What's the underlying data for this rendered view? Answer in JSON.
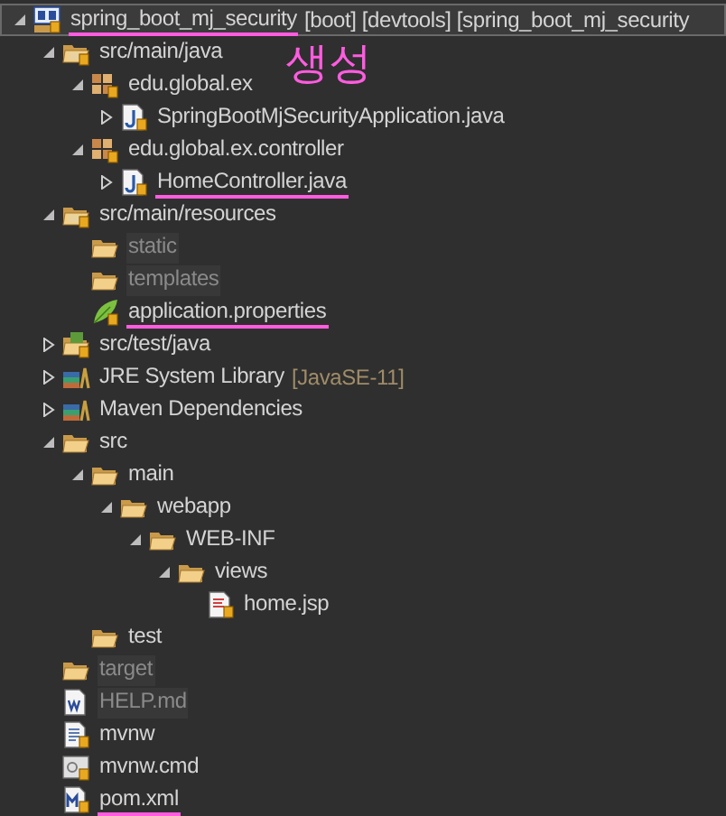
{
  "annotation": {
    "text": "생성"
  },
  "tree": [
    {
      "label": "spring_boot_mj_security",
      "decoration": "[boot] [devtools] [spring_boot_mj_security",
      "kind": "project",
      "expanded": true,
      "selected": true,
      "dimmed": false,
      "underlined": true,
      "children": [
        {
          "label": "src/main/java",
          "kind": "source-folder",
          "expanded": true,
          "selected": false,
          "dimmed": false,
          "underlined": false,
          "children": [
            {
              "label": "edu.global.ex",
              "kind": "package",
              "expanded": true,
              "selected": false,
              "dimmed": false,
              "underlined": false,
              "children": [
                {
                  "label": "SpringBootMjSecurityApplication.java",
                  "kind": "java-file",
                  "expanded": false,
                  "selected": false,
                  "dimmed": false,
                  "underlined": false
                }
              ]
            },
            {
              "label": "edu.global.ex.controller",
              "kind": "package",
              "expanded": true,
              "selected": false,
              "dimmed": false,
              "underlined": false,
              "children": [
                {
                  "label": "HomeController.java",
                  "kind": "java-file",
                  "expanded": false,
                  "selected": false,
                  "dimmed": false,
                  "underlined": true
                }
              ]
            }
          ]
        },
        {
          "label": "src/main/resources",
          "kind": "source-folder",
          "expanded": true,
          "selected": false,
          "dimmed": false,
          "underlined": false,
          "children": [
            {
              "label": "static",
              "kind": "folder",
              "selected": false,
              "dimmed": true,
              "underlined": false
            },
            {
              "label": "templates",
              "kind": "folder",
              "selected": false,
              "dimmed": true,
              "underlined": false
            },
            {
              "label": "application.properties",
              "kind": "properties-file",
              "selected": false,
              "dimmed": false,
              "underlined": true
            }
          ]
        },
        {
          "label": "src/test/java",
          "kind": "test-folder",
          "expanded": false,
          "selected": false,
          "dimmed": false,
          "underlined": false
        },
        {
          "label": "JRE System Library",
          "decoration": "[JavaSE-11]",
          "kind": "library",
          "expanded": false,
          "selected": false,
          "dimmed": false,
          "underlined": false
        },
        {
          "label": "Maven Dependencies",
          "kind": "library",
          "expanded": false,
          "selected": false,
          "dimmed": false,
          "underlined": false
        },
        {
          "label": "src",
          "kind": "folder",
          "expanded": true,
          "selected": false,
          "dimmed": false,
          "underlined": false,
          "children": [
            {
              "label": "main",
              "kind": "folder",
              "expanded": true,
              "selected": false,
              "dimmed": false,
              "underlined": false,
              "children": [
                {
                  "label": "webapp",
                  "kind": "folder",
                  "expanded": true,
                  "selected": false,
                  "dimmed": false,
                  "underlined": false,
                  "children": [
                    {
                      "label": "WEB-INF",
                      "kind": "folder",
                      "expanded": true,
                      "selected": false,
                      "dimmed": false,
                      "underlined": false,
                      "children": [
                        {
                          "label": "views",
                          "kind": "folder",
                          "expanded": true,
                          "selected": false,
                          "dimmed": false,
                          "underlined": false,
                          "children": [
                            {
                              "label": "home.jsp",
                              "kind": "jsp-file",
                              "selected": false,
                              "dimmed": false,
                              "underlined": false
                            }
                          ]
                        }
                      ]
                    }
                  ]
                }
              ]
            },
            {
              "label": "test",
              "kind": "folder",
              "selected": false,
              "dimmed": false,
              "underlined": false
            }
          ]
        },
        {
          "label": "target",
          "kind": "folder",
          "selected": false,
          "dimmed": true,
          "underlined": false
        },
        {
          "label": "HELP.md",
          "kind": "markdown-file",
          "selected": false,
          "dimmed": true,
          "underlined": false
        },
        {
          "label": "mvnw",
          "kind": "text-file",
          "selected": false,
          "dimmed": false,
          "underlined": false
        },
        {
          "label": "mvnw.cmd",
          "kind": "cmd-file",
          "selected": false,
          "dimmed": false,
          "underlined": false
        },
        {
          "label": "pom.xml",
          "kind": "maven-file",
          "selected": false,
          "dimmed": false,
          "underlined": true
        }
      ]
    }
  ]
}
